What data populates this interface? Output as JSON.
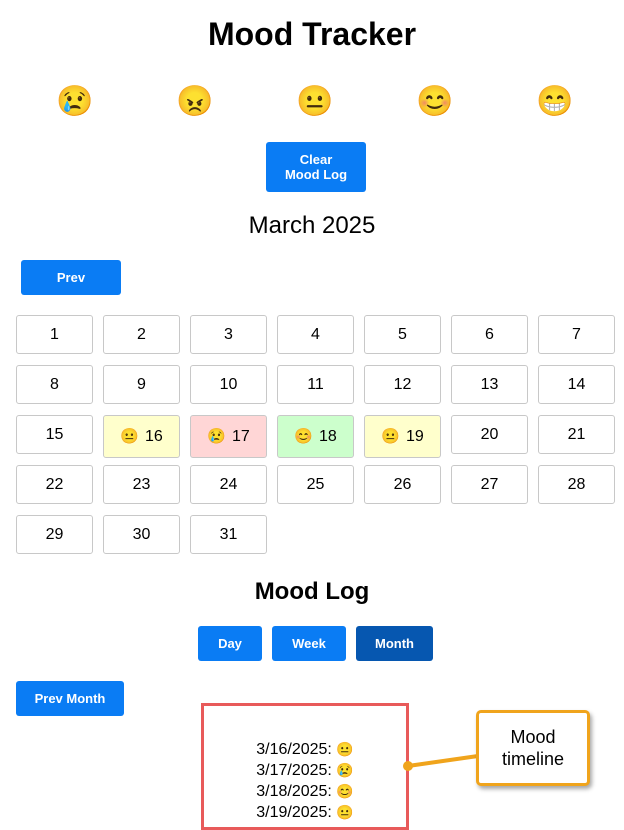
{
  "app": {
    "title": "Mood Tracker"
  },
  "mood_options": [
    {
      "icon": "sad-tear-face-icon",
      "glyph": "😢"
    },
    {
      "icon": "angry-face-icon",
      "glyph": "😠"
    },
    {
      "icon": "neutral-face-icon",
      "glyph": "😐"
    },
    {
      "icon": "smiling-face-icon",
      "glyph": "😊"
    },
    {
      "icon": "grinning-face-icon",
      "glyph": "😁"
    }
  ],
  "controls": {
    "clear_label": "Clear Mood Log"
  },
  "calendar": {
    "month_label": "March 2025",
    "prev_label": "Prev",
    "days": [
      {
        "day": "1"
      },
      {
        "day": "2"
      },
      {
        "day": "3"
      },
      {
        "day": "4"
      },
      {
        "day": "5"
      },
      {
        "day": "6"
      },
      {
        "day": "7"
      },
      {
        "day": "8"
      },
      {
        "day": "9"
      },
      {
        "day": "10"
      },
      {
        "day": "11"
      },
      {
        "day": "12"
      },
      {
        "day": "13"
      },
      {
        "day": "14"
      },
      {
        "day": "15"
      },
      {
        "day": "16",
        "mood": "😐",
        "mood_icon": "neutral-face-icon",
        "color": "#ffffcc"
      },
      {
        "day": "17",
        "mood": "😢",
        "mood_icon": "sad-tear-face-icon",
        "color": "#ffd6d6"
      },
      {
        "day": "18",
        "mood": "😊",
        "mood_icon": "smiling-face-icon",
        "color": "#ccffcc"
      },
      {
        "day": "19",
        "mood": "😐",
        "mood_icon": "neutral-face-icon",
        "color": "#ffffcc"
      },
      {
        "day": "20"
      },
      {
        "day": "21"
      },
      {
        "day": "22"
      },
      {
        "day": "23"
      },
      {
        "day": "24"
      },
      {
        "day": "25"
      },
      {
        "day": "26"
      },
      {
        "day": "27"
      },
      {
        "day": "28"
      },
      {
        "day": "29"
      },
      {
        "day": "30"
      },
      {
        "day": "31"
      }
    ]
  },
  "mood_log": {
    "title": "Mood Log",
    "views": [
      {
        "label": "Day",
        "active": false
      },
      {
        "label": "Week",
        "active": false
      },
      {
        "label": "Month",
        "active": true
      }
    ],
    "prev_label": "Prev Month",
    "entries": [
      {
        "date": "3/16/2025:",
        "mood": "😐"
      },
      {
        "date": "3/17/2025:",
        "mood": "😢"
      },
      {
        "date": "3/18/2025:",
        "mood": "😊"
      },
      {
        "date": "3/19/2025:",
        "mood": "😐"
      }
    ]
  },
  "annotation": {
    "text": "Mood timeline"
  },
  "colors": {
    "button": "#0a7cf4",
    "button_active": "#0657b0",
    "neutral_day": "#ffffcc",
    "sad_day": "#ffd6d6",
    "happy_day": "#ccffcc",
    "highlight_border": "#e85a5a",
    "callout_border": "#f0a41c"
  }
}
